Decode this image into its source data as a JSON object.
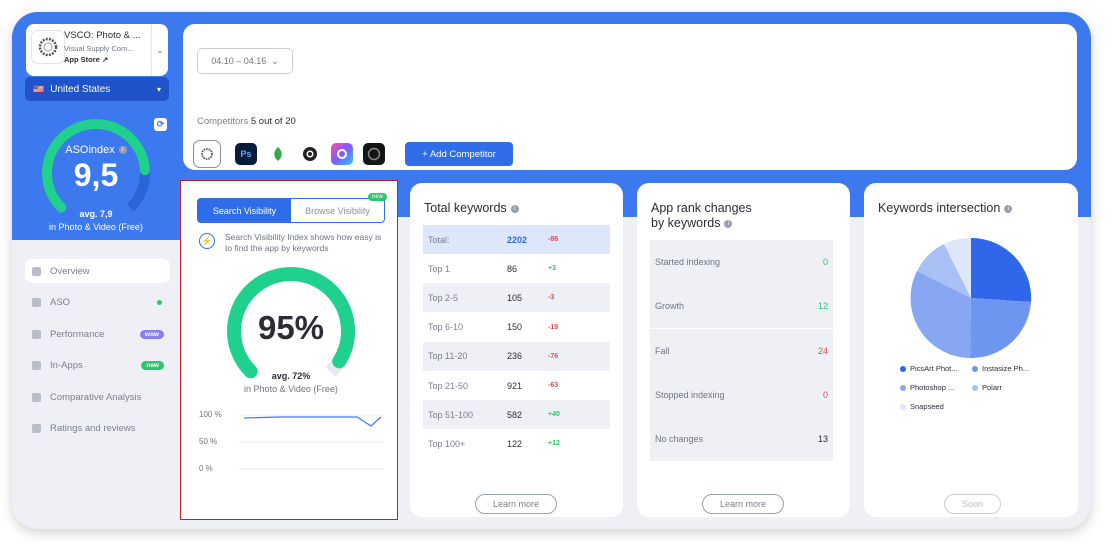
{
  "app": {
    "name": "VSCO: Photo & ...",
    "developer": "Visual Supply Com...",
    "store": "App Store"
  },
  "country": "United States",
  "aso": {
    "label": "ASOindex",
    "value": "9,5",
    "avg": "avg. 7,9",
    "category": "in Photo & Video (Free)",
    "gauge_fraction": 0.82
  },
  "nav": [
    {
      "label": "Overview"
    },
    {
      "label": "ASO"
    },
    {
      "label": "Performance",
      "badge": "wow",
      "badge_color": "#8b7ff0"
    },
    {
      "label": "In-Apps",
      "badge": "new",
      "badge_color": "#2ec66e"
    },
    {
      "label": "Comparative Analysis"
    },
    {
      "label": "Ratings and reviews"
    }
  ],
  "date_range": "04.10 – 04.16",
  "competitors": {
    "label": "Competitors",
    "count": "5 out of 20",
    "add_label": "+ Add Competitor"
  },
  "visibility": {
    "tab_active": "Search Visibility",
    "tab_inactive": "Browse Visibility",
    "new_badge": "new",
    "info": "Search Visibility Index shows how easy is to find the app by keywords",
    "value": "95%",
    "fraction": 0.95,
    "avg": "avg. 72%",
    "category": "in Photo & Video (Free)",
    "yticks": [
      "100 %",
      "50 %",
      "0 %"
    ]
  },
  "total_keywords": {
    "title": "Total keywords",
    "rows": [
      {
        "label": "Total:",
        "value": "2202",
        "delta": "-86"
      },
      {
        "label": "Top 1",
        "value": "86",
        "delta": "+3"
      },
      {
        "label": "Top 2-5",
        "value": "105",
        "delta": "-3"
      },
      {
        "label": "Top 6-10",
        "value": "150",
        "delta": "-19"
      },
      {
        "label": "Top 11-20",
        "value": "236",
        "delta": "-76"
      },
      {
        "label": "Top 21-50",
        "value": "921",
        "delta": "-63"
      },
      {
        "label": "Top 51-100",
        "value": "582",
        "delta": "+40"
      },
      {
        "label": "Top 100+",
        "value": "122",
        "delta": "+12"
      }
    ],
    "learn_more": "Learn more"
  },
  "rank_changes": {
    "title_line1": "App rank changes",
    "title_line2": "by keywords",
    "rows": [
      {
        "label": "Started indexing",
        "value": "0",
        "color": "#2ec66e"
      },
      {
        "label": "Growth",
        "value": "12",
        "color": "#2ec66e"
      },
      {
        "label": "Fall",
        "value": "24",
        "color": "#e5484d"
      },
      {
        "label": "Stopped indexing",
        "value": "0",
        "color": "#e5484d"
      },
      {
        "label": "No changes",
        "value": "13",
        "color": "#2a2d34"
      }
    ],
    "learn_more": "Learn more"
  },
  "intersection": {
    "title": "Keywords intersection",
    "legend": [
      {
        "name": "PicsArt Phot...",
        "color": "#2f66ea"
      },
      {
        "name": "Instasize Ph...",
        "color": "#6e95f0"
      },
      {
        "name": "Photoshop ...",
        "color": "#87a7f2"
      },
      {
        "name": "Polarr",
        "color": "#a9c0f5"
      },
      {
        "name": "Snapseed",
        "color": "#dde6fb"
      }
    ],
    "soon": "Soon"
  }
}
